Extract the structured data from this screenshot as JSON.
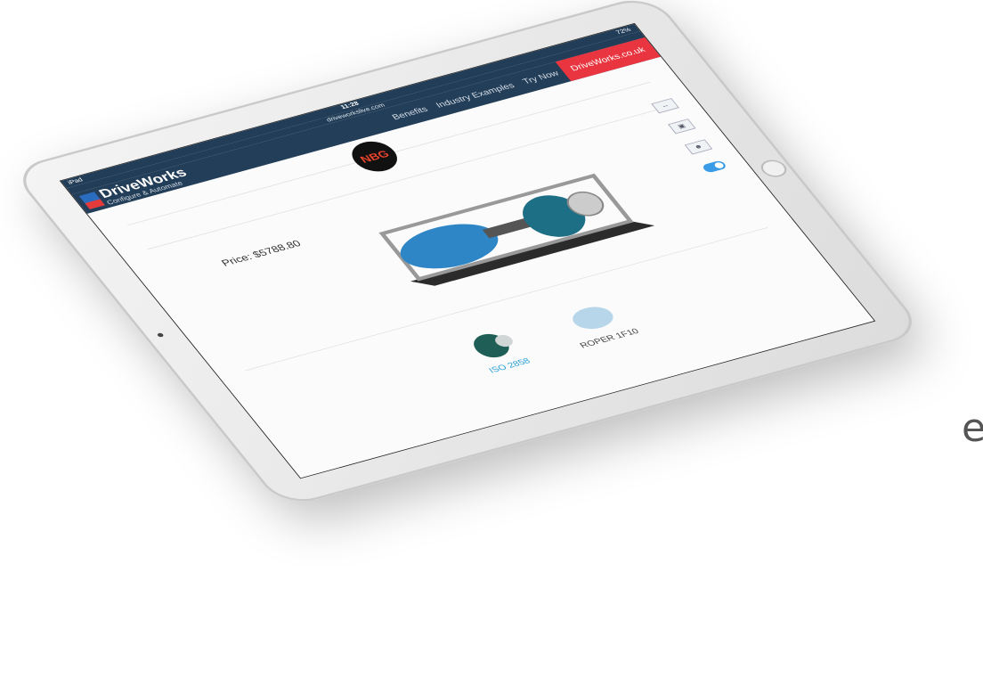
{
  "background": {
    "cut_text": "e"
  },
  "status_bar": {
    "carrier": "iPad",
    "time": "11:28",
    "battery": "72%"
  },
  "url_bar": {
    "url": "driveworkslive.com"
  },
  "nav": {
    "logo": {
      "brand": "DriveWorks",
      "tagline": "Configure & Automate",
      "badge_top": "Drive",
      "badge_bottom": "Works"
    },
    "links": [
      {
        "label": "Benefits"
      },
      {
        "label": "Industry Examples"
      },
      {
        "label": "Try Now"
      },
      {
        "label": "DriveWorks.co.uk"
      }
    ],
    "cta_color": "#e8353f",
    "bar_color": "#233e58"
  },
  "content": {
    "badge_text": "NBG",
    "price": "Price: $5788.80",
    "side_icons": [
      "dimension-view-icon",
      "side-view-icon",
      "person-scale-icon",
      "toggle-switch"
    ],
    "options": [
      {
        "label": "ISO 2858",
        "selected": true
      },
      {
        "label": "ROPER 1F10",
        "selected": false
      }
    ],
    "accent_color": "#2a9fd6"
  }
}
